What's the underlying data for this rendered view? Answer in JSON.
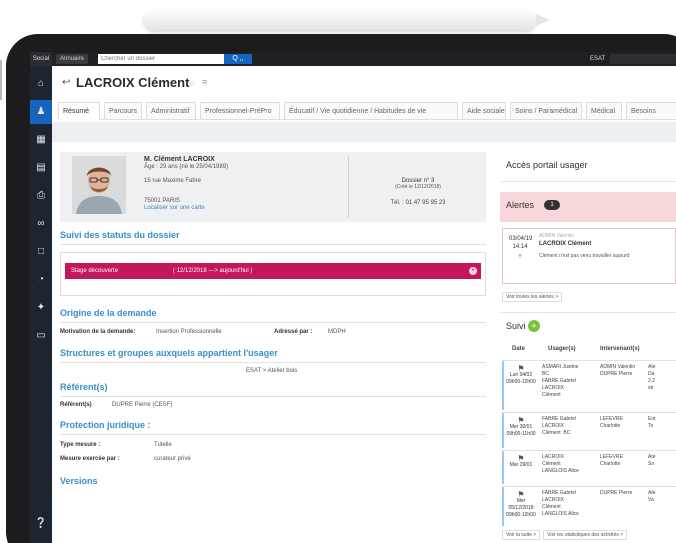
{
  "topbar": {
    "social": "Social",
    "annuaire": "Annuaire",
    "search_placeholder": "Chercher un dossier",
    "search_button": "Q ,,",
    "context": "ESAT"
  },
  "header": {
    "title": "LACROIX Clément"
  },
  "tabs": [
    {
      "label": "Résumé"
    },
    {
      "label": "Parcours"
    },
    {
      "label": "Administratif"
    },
    {
      "label": "Professionnel-PréPro"
    },
    {
      "label": "Éducatif / Vie quotidienne / Habitudes de vie"
    },
    {
      "label": "Aide sociale"
    },
    {
      "label": "Soins / Paramédical"
    },
    {
      "label": "Médical"
    },
    {
      "label": "Besoins"
    }
  ],
  "identity": {
    "name": "M. Clément LACROIX",
    "age": "Âge : 29 ans (né le 25/04/1989)",
    "street": "15 rue Maxime Fabre",
    "city": "75001 PARIS",
    "map_link": "Localiser sur une carte",
    "dossier": "Dossier n° 3",
    "cree": "(Créé le 12/12/2018)",
    "tel": "Tél. : 01 47 95 95 23"
  },
  "sections": {
    "suivi_statuts": "Suivi des statuts du dossier",
    "origine": "Origine de la demande",
    "structures": "Structures et groupes auxquels appartient l'usager",
    "referent": "Référent(s)",
    "protection": "Protection juridique :",
    "versions": "Versions"
  },
  "status": {
    "label": "Stage découverte",
    "dates": "( 12/12/2018 ---> aujourd'hui )"
  },
  "origine": {
    "motivation_label": "Motivation de la demande:",
    "motivation_value": "Insertion Professionnelle",
    "adresse_label": "Adressé par :",
    "adresse_value": "MDPH"
  },
  "structures": {
    "value": "ESAT > Atelier bois"
  },
  "referent": {
    "label": "Référent(s)",
    "value": "DUPRE Pierre (CESF)"
  },
  "protection": {
    "type_label": "Type mesure :",
    "type_value": "Tutelle",
    "exercee_label": "Mesure exercée par :",
    "exercee_value": "curateur privé"
  },
  "right": {
    "portail_title": "Accès portail usager",
    "alertes_title": "Alertes",
    "alertes_count": "1",
    "alert": {
      "date": "03/04/19\n14:14",
      "user": "ADMIN Valentin",
      "name": "LACROIX Clément",
      "text": "Clément n'est pas venu travailler aujourd"
    },
    "alert_link": "Voir toutes les alertes >",
    "suivi_title": "Suivi",
    "suivi_plus": "+",
    "suivi_cols": {
      "date": "Date",
      "usagers": "Usager(s)",
      "intervenants": "Intervenant(s)"
    },
    "suivi_rows": [
      {
        "date": "Lun 04/02\n09h00-12h00",
        "usagers": "ASMARI Justine\nBC\nFABRE Gabriel\nLACROIX\nClément",
        "intervenant": "ADMIN Valentin\nDUPRE Pierre",
        "extra": "Ate\nDa\n2.2\nstr"
      },
      {
        "date": "Mer 30/01\n09h00-11h00",
        "usagers": "FABRE Gabriel\nLACROIX\nClément  BC",
        "intervenant": "LEFEVRE\nCharlotte",
        "extra": "Ent\nTo"
      },
      {
        "date": "Mar 29/01",
        "usagers": "LACROIX\nClément\nLANGLOIS Alice",
        "intervenant": "LEFEVRE\nCharlotte",
        "extra": "Ate\nSo"
      },
      {
        "date": "Mer\n05/12/2018\n09h00-12h00",
        "usagers": "FABRE Gabriel\nLACROIX\nClément\nLANGLOIS Alice",
        "intervenant": "DUPRE Pierre",
        "extra": "Ate\nVa"
      }
    ],
    "bottom_link_1": "Voir la suite >",
    "bottom_link_2": "Voir les statistiques des activités >"
  }
}
